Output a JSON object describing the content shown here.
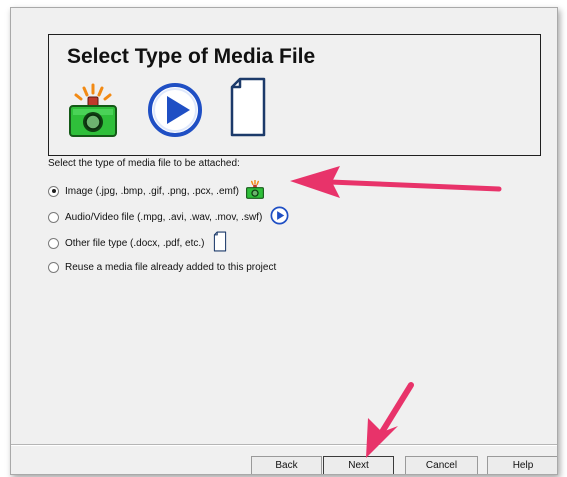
{
  "header": {
    "title": "Select Type of Media File"
  },
  "header_icons": [
    "camera-flash-icon",
    "play-icon",
    "document-icon"
  ],
  "instruction": "Select the type of media file to be attached:",
  "options": [
    {
      "label": "Image (.jpg, .bmp, .gif, .png, .pcx, .emf)",
      "selected": true,
      "icon": "camera-flash-icon"
    },
    {
      "label": "Audio/Video file (.mpg, .avi, .wav, .mov, .swf)",
      "selected": false,
      "icon": "play-icon"
    },
    {
      "label": "Other file type (.docx, .pdf, etc.)",
      "selected": false,
      "icon": "document-icon"
    },
    {
      "label": "Reuse a media file already added to this project",
      "selected": false,
      "icon": ""
    }
  ],
  "buttons": {
    "back": "Back",
    "next": "Next",
    "cancel": "Cancel",
    "help": "Help"
  },
  "colors": {
    "annotation_arrow": "#e8336a",
    "camera_green": "#2fbf3a",
    "play_blue": "#1f4fc4"
  }
}
